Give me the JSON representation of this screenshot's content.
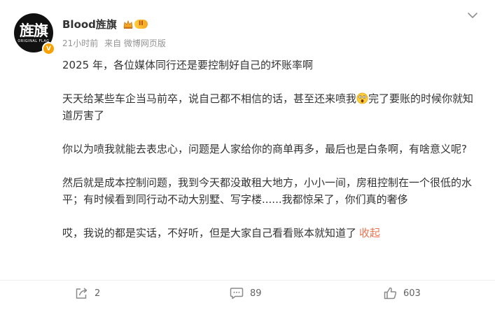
{
  "user": {
    "name": "Blood旌旗",
    "avatar_text": "旌旗",
    "avatar_subtext": "ORIGINAL FLAG",
    "verified_mark": "V",
    "level": "II"
  },
  "meta": {
    "time": "21小时前",
    "source": "来自 微博网页版"
  },
  "post": {
    "p1": "2025 年，各位媒体同行还是要控制好自己的坏账率啊",
    "p2a": "天天给某些车企当马前卒，说自己都不相信的话，甚至还来喷我",
    "p2b": "完了要账的时候你就知道厉害了",
    "p3": "你以为喷我就能去表忠心，问题是人家给你的商单再多，最后也是白条啊，有啥意义呢?",
    "p4": "然后就是成本控制问题，我到今天都没敢租大地方，小小一间，房租控制在一个很低的水平；有时候看到同行动不动大别墅、写字楼......我都惊呆了，你们真的奢侈",
    "p5": "哎，我说的都是实话，不好听，但是大家自己看看账本就知道了",
    "collapse": "收起"
  },
  "actions": {
    "repost": "2",
    "comment": "89",
    "like": "603"
  },
  "colors": {
    "accent": "#eb7350",
    "text": "#333333",
    "meta": "#939393",
    "badge": "#f8a100"
  },
  "icons": [
    "more-chevron-icon",
    "repost-icon",
    "comment-icon",
    "like-icon",
    "crown-icon",
    "stunned-emoji-icon"
  ]
}
